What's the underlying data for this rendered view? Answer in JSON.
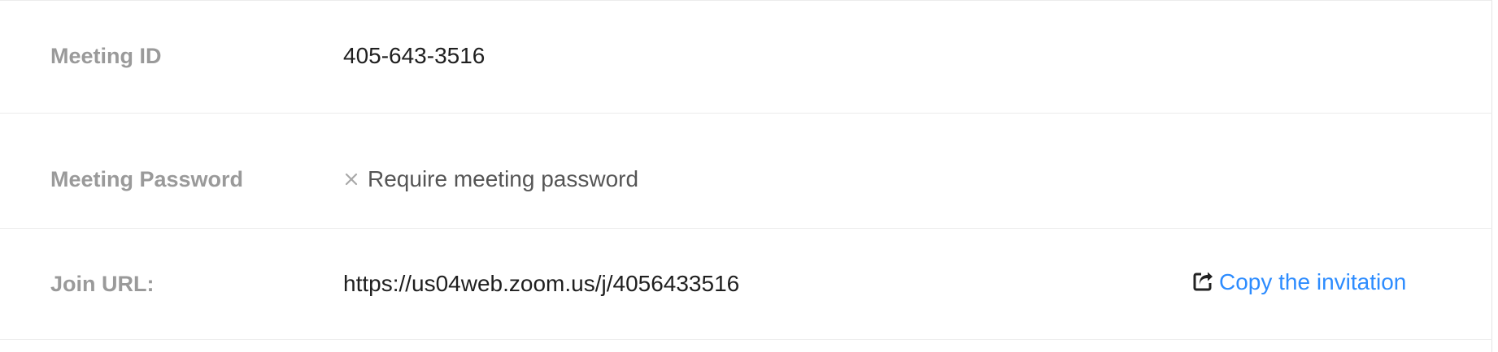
{
  "meeting_id": {
    "label": "Meeting ID",
    "value": "405-643-3516"
  },
  "meeting_password": {
    "label": "Meeting Password",
    "value": "Require meeting password",
    "state_icon": "x-icon"
  },
  "join_url": {
    "label": "Join URL:",
    "value": "https://us04web.zoom.us/j/4056433516",
    "copy_label": "Copy the invitation",
    "copy_icon": "share-icon"
  },
  "colors": {
    "label": "#9a9a9a",
    "value": "#1f1f1f",
    "link": "#2d8cff",
    "divider": "#ececec"
  }
}
